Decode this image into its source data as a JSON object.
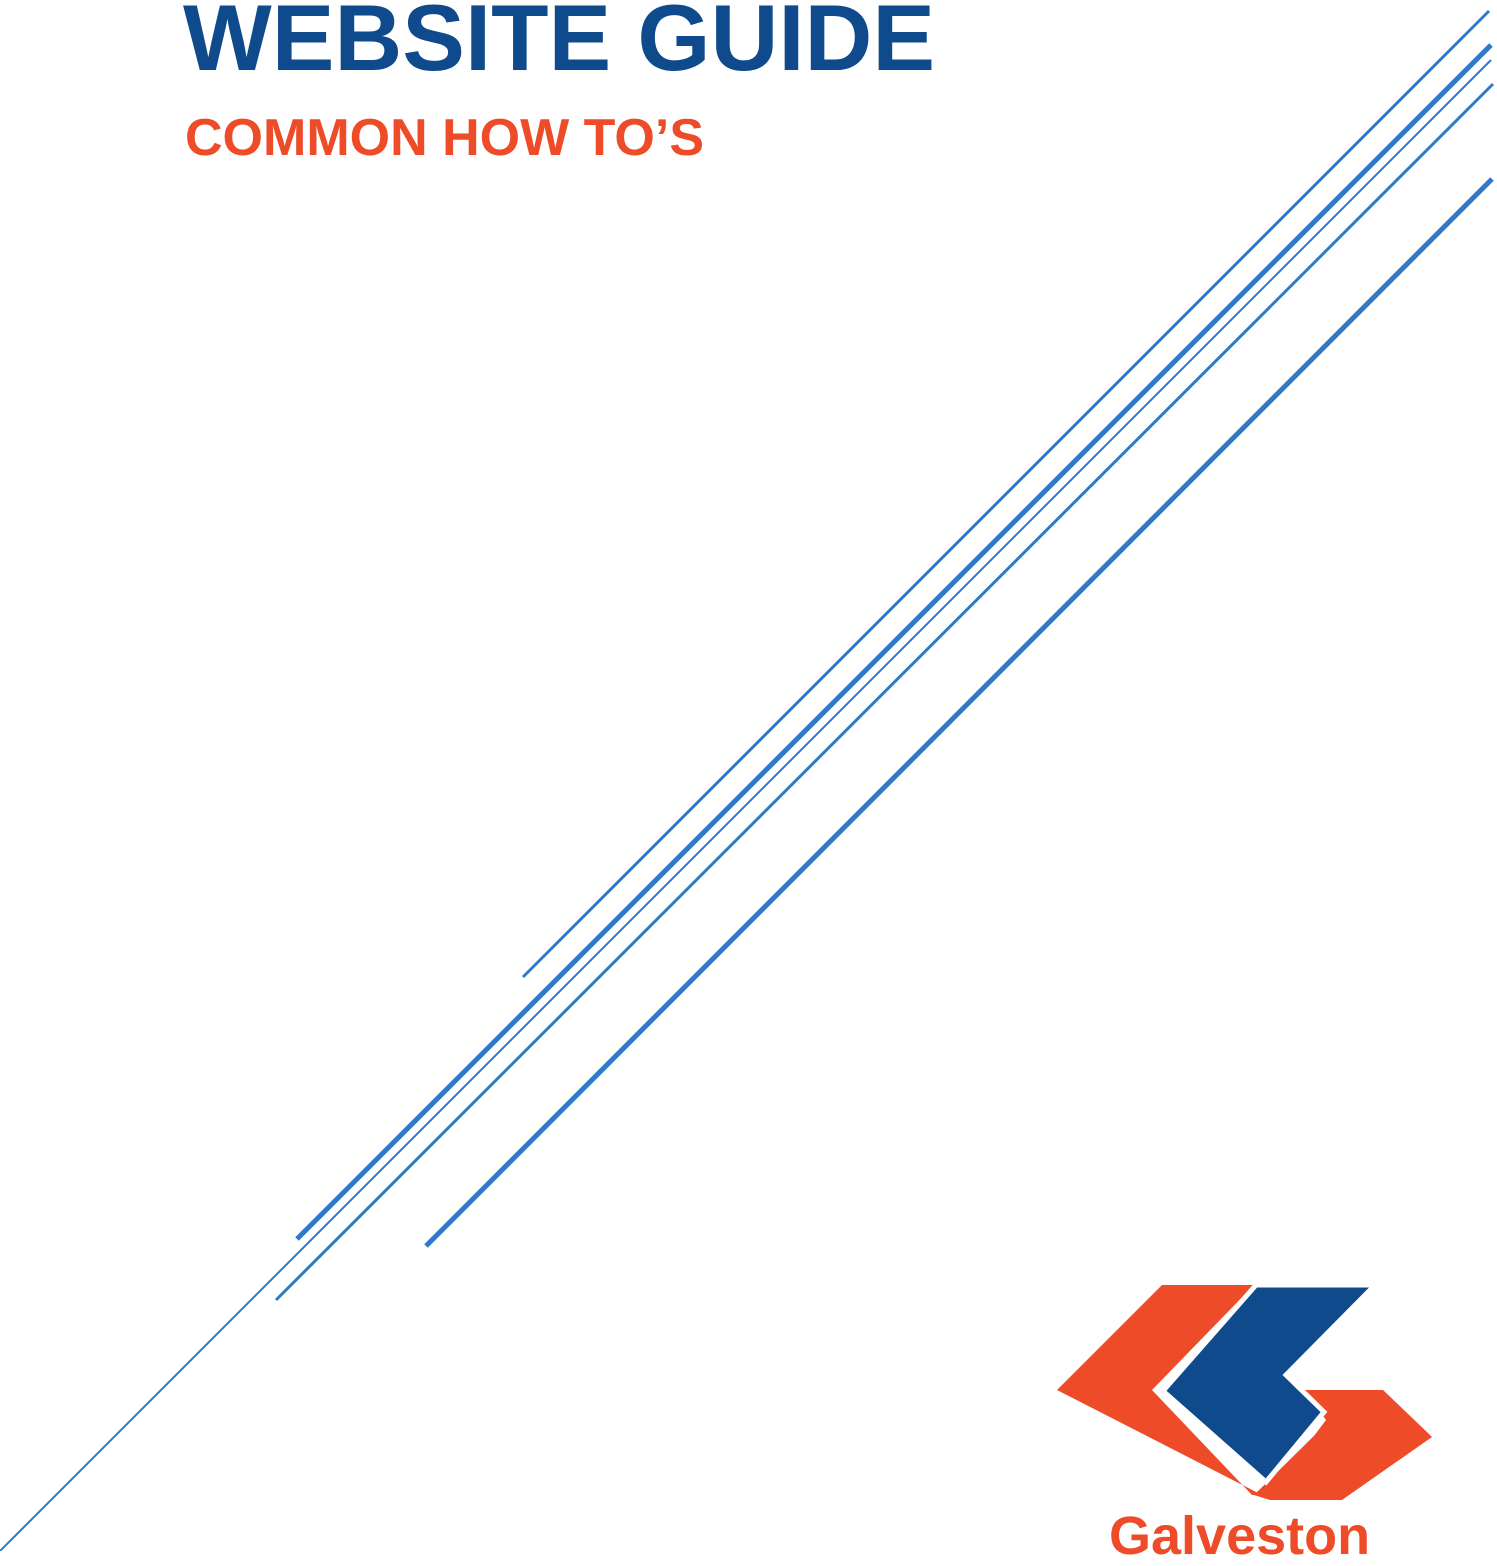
{
  "document": {
    "title": "WEBSITE GUIDE",
    "subtitle": "COMMON HOW TO’S"
  },
  "logo": {
    "wordmark": "Galveston",
    "icon": "galveston-g-mark-icon"
  },
  "colors": {
    "title": "#0e4a8c",
    "subtitle": "#ee4b28",
    "lines": "#2f79c9",
    "logo_orange": "#ee4b28",
    "logo_blue": "#0e4a8c",
    "background": "#ffffff"
  }
}
